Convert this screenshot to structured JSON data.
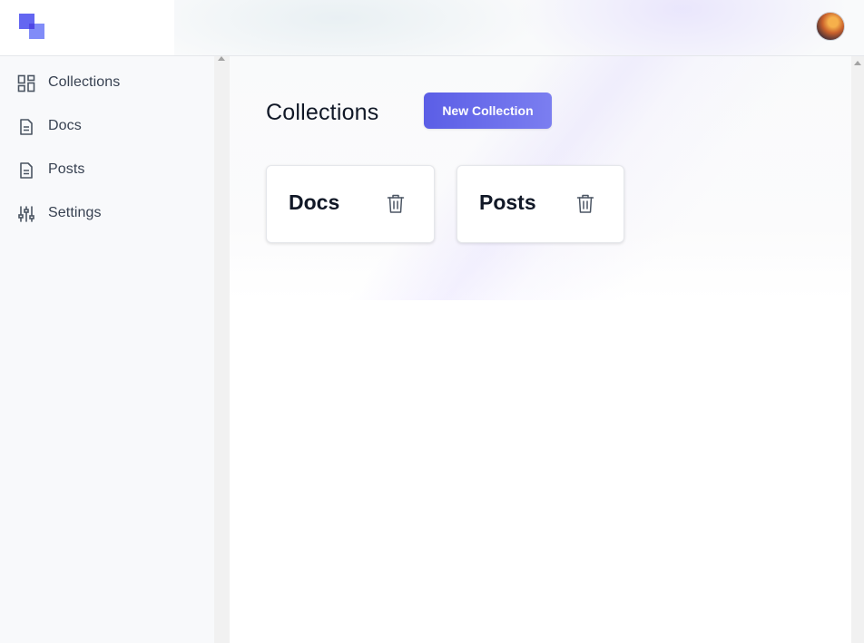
{
  "header": {
    "logo_icon": "app-logo-icon",
    "avatar_icon": "user-avatar"
  },
  "sidebar": {
    "items": [
      {
        "label": "Collections",
        "icon": "dashboard-grid-icon"
      },
      {
        "label": "Docs",
        "icon": "document-icon"
      },
      {
        "label": "Posts",
        "icon": "document-icon"
      },
      {
        "label": "Settings",
        "icon": "sliders-icon"
      }
    ]
  },
  "main": {
    "title": "Collections",
    "new_button_label": "New Collection",
    "cards": [
      {
        "title": "Docs",
        "action_icon": "trash-icon"
      },
      {
        "title": "Posts",
        "action_icon": "trash-icon"
      }
    ]
  },
  "colors": {
    "accent": "#6366f1",
    "sidebar_bg": "#f8f9fb",
    "text": "#111827"
  }
}
